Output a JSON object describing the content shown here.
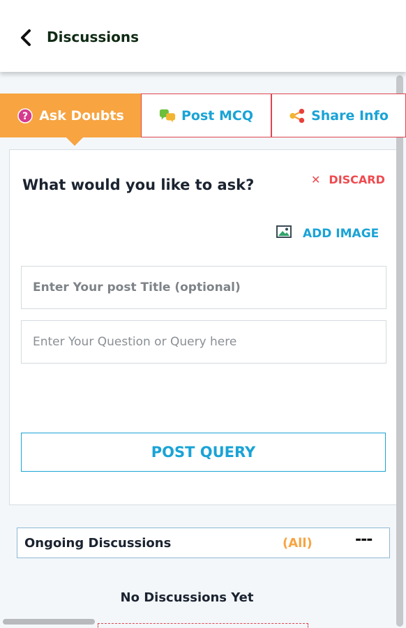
{
  "header": {
    "title": "Discussions",
    "back_icon": "chevron-left-icon"
  },
  "tabs": [
    {
      "label": "Ask Doubts",
      "icon": "question-circle-icon",
      "active": true,
      "color": "#f7a441"
    },
    {
      "label": "Post MCQ",
      "icon": "chat-bubbles-icon",
      "active": false
    },
    {
      "label": "Share Info",
      "icon": "share-icon",
      "active": false
    }
  ],
  "composer": {
    "heading": "What would you like to ask?",
    "discard_label": "DISCARD",
    "discard_icon": "close-icon",
    "add_image_label": "ADD IMAGE",
    "add_image_icon": "image-icon",
    "title_placeholder": "Enter Your post Title (optional)",
    "question_placeholder": "Enter Your Question or Query here",
    "submit_label": "POST QUERY"
  },
  "ongoing": {
    "title": "Ongoing Discussions",
    "filter_label": "(All)",
    "more_label": "---"
  },
  "empty_state": "No Discussions Yet",
  "colors": {
    "accent_orange": "#f7a441",
    "accent_blue": "#1aa3d6",
    "danger_red": "#ef4a4f"
  }
}
